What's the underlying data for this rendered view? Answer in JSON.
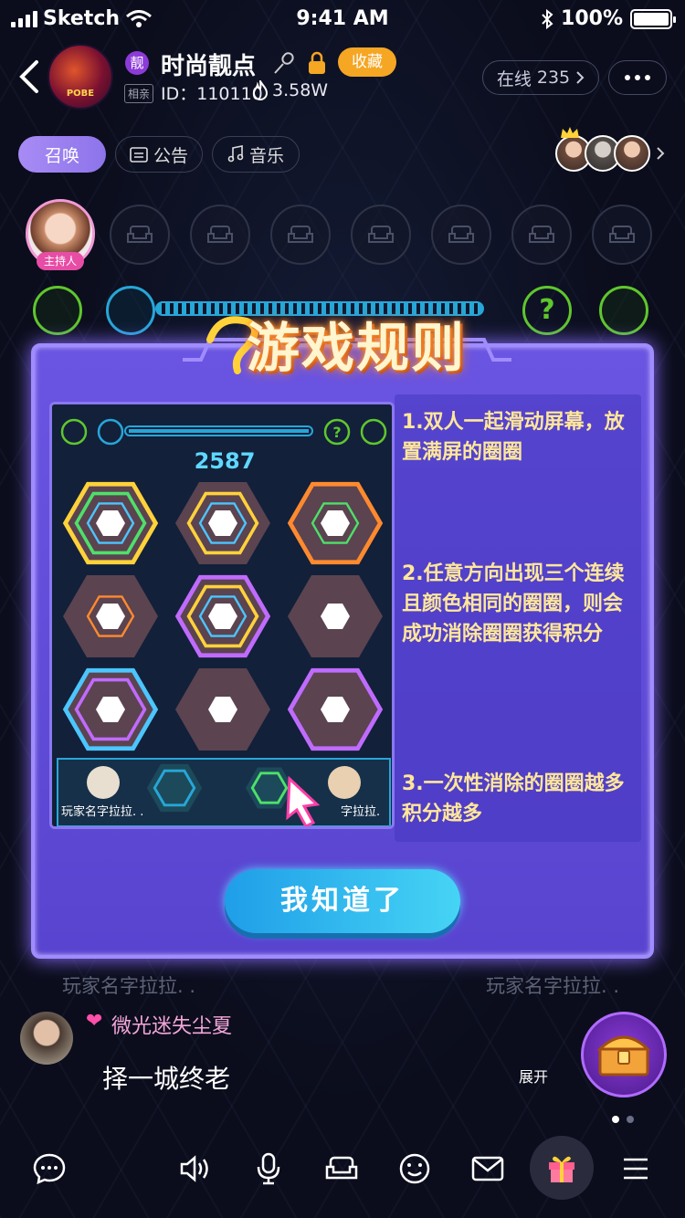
{
  "status_bar": {
    "carrier": "Sketch",
    "time": "9:41 AM",
    "battery": "100%"
  },
  "room": {
    "tag_liang": "靓",
    "title": "时尚靓点",
    "favorite_label": "收藏",
    "tag_xiangqin": "相亲",
    "id_text": "ID：110110",
    "heat": "3.58W",
    "online_label": "在线",
    "online_count": "235",
    "avatar_text": "POBE"
  },
  "pills": {
    "summon": "召唤",
    "notice": "公告",
    "music": "音乐"
  },
  "host_tag": "主持人",
  "game_bg": {
    "player_left": "玩家名字拉拉. .",
    "player_right": "玩家名字拉拉. ."
  },
  "modal": {
    "title": "游戏规则",
    "preview": {
      "score": "2587",
      "player_left": "玩家名字拉拉. .",
      "player_right": "字拉拉."
    },
    "rules": [
      "1.双人一起滑动屏幕，放置满屏的圈圈",
      "2.任意方向出现三个连续且颜色相同的圈圈，则会成功消除圈圈获得积分",
      "3.一次性消除的圈圈越多积分越多"
    ],
    "ok_button": "我知道了"
  },
  "chat": {
    "name": "微光迷失尘夏",
    "message": "择一城终老",
    "expand": "展开"
  },
  "colors": {
    "accent_purple": "#6a55e2",
    "button_blue": "#1f9ee8",
    "rule_text": "#ffe79a",
    "fav_orange": "#f5a623"
  }
}
